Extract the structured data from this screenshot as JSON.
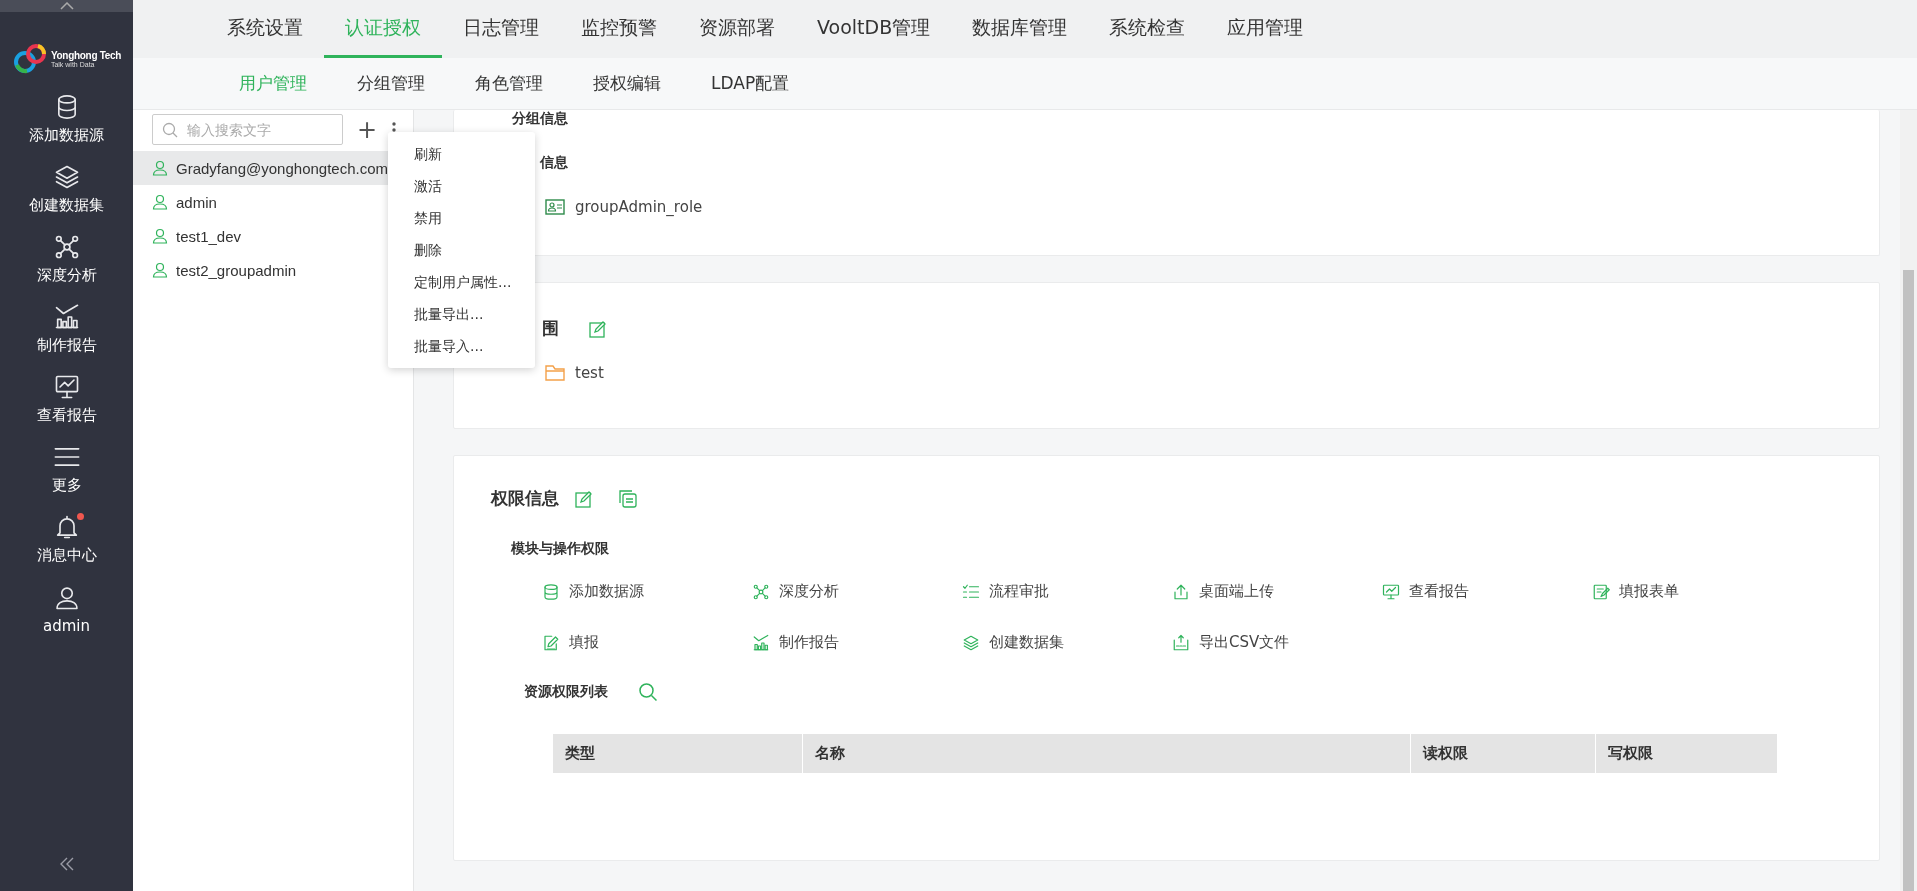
{
  "sidebar": {
    "logo": {
      "name": "Yonghong Tech",
      "tagline": "Talk with Data"
    },
    "items": [
      {
        "label": "添加数据源",
        "kind": "database"
      },
      {
        "label": "创建数据集",
        "kind": "layers"
      },
      {
        "label": "深度分析",
        "kind": "network"
      },
      {
        "label": "制作报告",
        "kind": "chart"
      },
      {
        "label": "查看报告",
        "kind": "monitor"
      },
      {
        "label": "更多",
        "kind": "menu"
      },
      {
        "label": "消息中心",
        "kind": "bell",
        "unread": true
      },
      {
        "label": "admin",
        "kind": "user"
      }
    ]
  },
  "top_tabs": [
    {
      "label": "系统设置",
      "selected": false
    },
    {
      "label": "认证授权",
      "selected": true
    },
    {
      "label": "日志管理",
      "selected": false
    },
    {
      "label": "监控预警",
      "selected": false
    },
    {
      "label": "资源部署",
      "selected": false
    },
    {
      "label": "VooltDB管理",
      "selected": false
    },
    {
      "label": "数据库管理",
      "selected": false
    },
    {
      "label": "系统检查",
      "selected": false
    },
    {
      "label": "应用管理",
      "selected": false
    }
  ],
  "sub_tabs": [
    {
      "label": "用户管理",
      "selected": true
    },
    {
      "label": "分组管理",
      "selected": false
    },
    {
      "label": "角色管理",
      "selected": false
    },
    {
      "label": "授权编辑",
      "selected": false
    },
    {
      "label": "LDAP配置",
      "selected": false
    }
  ],
  "search": {
    "placeholder": "输入搜索文字"
  },
  "add_button": "+",
  "users": [
    {
      "name": "Gradyfang@yonghongtech.com",
      "selected": true
    },
    {
      "name": "admin",
      "selected": false
    },
    {
      "name": "test1_dev",
      "selected": false
    },
    {
      "name": "test2_groupadmin",
      "selected": false
    }
  ],
  "context_menu": [
    "刷新",
    "激活",
    "禁用",
    "删除",
    "定制用户属性...",
    "批量导出...",
    "批量导入..."
  ],
  "group_card": {
    "group_heading": "分组信息",
    "role_heading": "信息",
    "roles": [
      "groupAdmin_role"
    ]
  },
  "scope_card": {
    "heading": "围",
    "items": [
      "test"
    ]
  },
  "perm_card": {
    "heading": "权限信息",
    "module_heading": "模块与操作权限",
    "modules": [
      {
        "label": "添加数据源",
        "kind": "database"
      },
      {
        "label": "深度分析",
        "kind": "network"
      },
      {
        "label": "流程审批",
        "kind": "flow"
      },
      {
        "label": "桌面端上传",
        "kind": "upload"
      },
      {
        "label": "查看报告",
        "kind": "monitor"
      },
      {
        "label": "填报表单",
        "kind": "form"
      },
      {
        "label": "填报",
        "kind": "edit-doc"
      },
      {
        "label": "制作报告",
        "kind": "chart"
      },
      {
        "label": "创建数据集",
        "kind": "layers"
      },
      {
        "label": "导出CSV文件",
        "kind": "csv"
      }
    ],
    "resource_heading": "资源权限列表",
    "table": {
      "columns": [
        "类型",
        "名称",
        "读权限",
        "写权限"
      ]
    }
  }
}
